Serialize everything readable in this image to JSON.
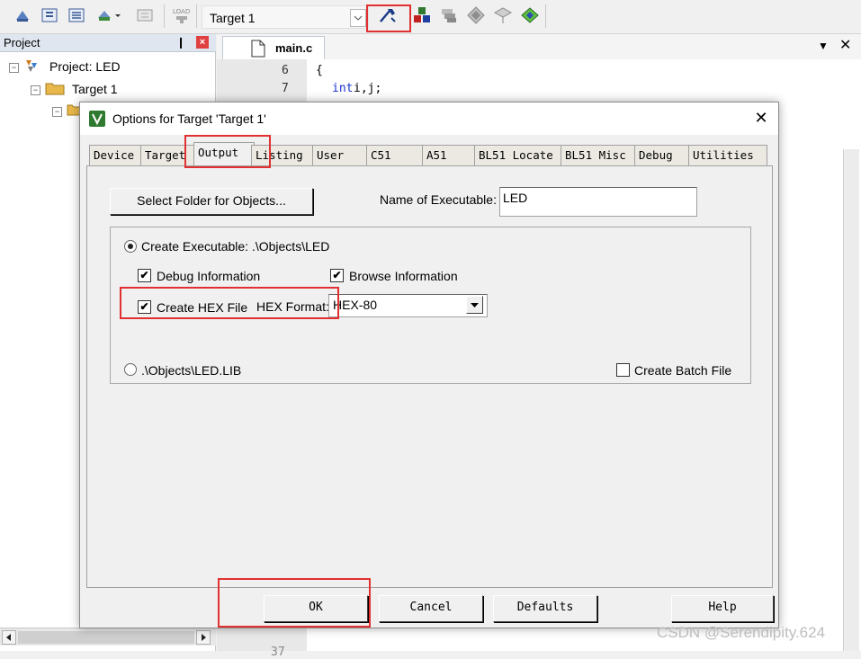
{
  "toolbar": {
    "target_name": "Target 1",
    "load_label": "LOAD"
  },
  "project": {
    "title": "Project",
    "pin": "❙",
    "close": "×",
    "tree": {
      "project": "Project: LED",
      "target": "Target 1"
    }
  },
  "editor": {
    "tab_title": "main.c",
    "lines": [
      {
        "num": "6",
        "text": "{"
      },
      {
        "num": "7",
        "keyword": "int",
        "text": " i,j;"
      }
    ],
    "hidden_line": "37"
  },
  "dialog": {
    "title": "Options for Target 'Target 1'",
    "close": "✕",
    "tabs": [
      "Device",
      "Target",
      "Output",
      "Listing",
      "User",
      "C51",
      "A51",
      "BL51 Locate",
      "BL51 Misc",
      "Debug",
      "Utilities"
    ],
    "output": {
      "select_folder_label": "Select Folder for Objects...",
      "name_exec_label": "Name of Executable:",
      "name_exec_value": "LED",
      "create_exec_label": "Create Executable:  .\\Objects\\LED",
      "debug_info_label": "Debug Information",
      "browse_info_label": "Browse Information",
      "create_hex_label": "Create HEX File",
      "hex_format_label": "HEX Format:",
      "hex_format_value": "HEX-80",
      "lib_label": ".\\Objects\\LED.LIB",
      "batch_label": "Create Batch File",
      "check_mark": "✔"
    },
    "buttons": {
      "ok": "OK",
      "cancel": "Cancel",
      "defaults": "Defaults",
      "help": "Help"
    }
  },
  "watermark": "CSDN @Serendipity.624",
  "colors": {
    "highlight": "#e03030",
    "keyword": "#1a33cc"
  }
}
